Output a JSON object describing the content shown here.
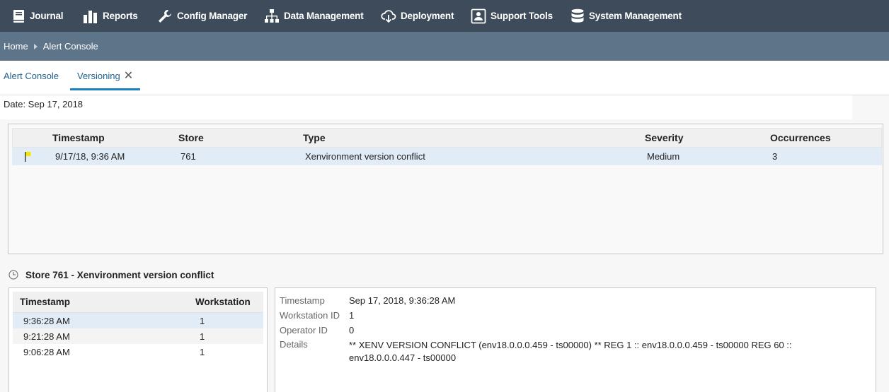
{
  "nav": {
    "items": [
      {
        "label": "Journal",
        "icon": "journal-icon"
      },
      {
        "label": "Reports",
        "icon": "reports-icon"
      },
      {
        "label": "Config Manager",
        "icon": "wrench-icon"
      },
      {
        "label": "Data Management",
        "icon": "hierarchy-icon"
      },
      {
        "label": "Deployment",
        "icon": "cloud-download-icon"
      },
      {
        "label": "Support Tools",
        "icon": "support-icon"
      },
      {
        "label": "System Management",
        "icon": "database-icon"
      }
    ]
  },
  "breadcrumb": {
    "home": "Home",
    "current": "Alert Console"
  },
  "tabs": [
    {
      "label": "Alert Console"
    },
    {
      "label": "Versioning",
      "close": "✕"
    }
  ],
  "date_label": "Date: Sep 17, 2018",
  "alert_table": {
    "columns": [
      "Timestamp",
      "Store",
      "Type",
      "Severity",
      "Occurrences"
    ],
    "rows": [
      {
        "timestamp": "9/17/18, 9:36 AM",
        "store": "761",
        "type": "Xenvironment version conflict",
        "severity": "Medium",
        "occurrences": "3",
        "flag_color": "#f2e600"
      }
    ]
  },
  "section_title": "Store 761 - Xenvironment version conflict",
  "history_table": {
    "columns": [
      "Timestamp",
      "Workstation"
    ],
    "rows": [
      {
        "timestamp": "9:36:28 AM",
        "workstation": "1"
      },
      {
        "timestamp": "9:21:28 AM",
        "workstation": "1"
      },
      {
        "timestamp": "9:06:28 AM",
        "workstation": "1"
      }
    ]
  },
  "details": {
    "timestamp_label": "Timestamp",
    "timestamp_value": "Sep 17, 2018, 9:36:28 AM",
    "workstation_label": "Workstation ID",
    "workstation_value": "1",
    "operator_label": "Operator ID",
    "operator_value": "0",
    "details_label": "Details",
    "details_value": "** XENV VERSION CONFLICT (env18.0.0.0.459 - ts00000) ** REG 1 :: env18.0.0.0.459 - ts00000 REG 60 :: env18.0.0.0.447 - ts00000"
  },
  "colors": {
    "nav_bg": "#3d4b5a",
    "breadcrumb_bg": "#5e7489",
    "selected_row": "#e1ecf7",
    "tab_accent": "#1a7fbf"
  }
}
